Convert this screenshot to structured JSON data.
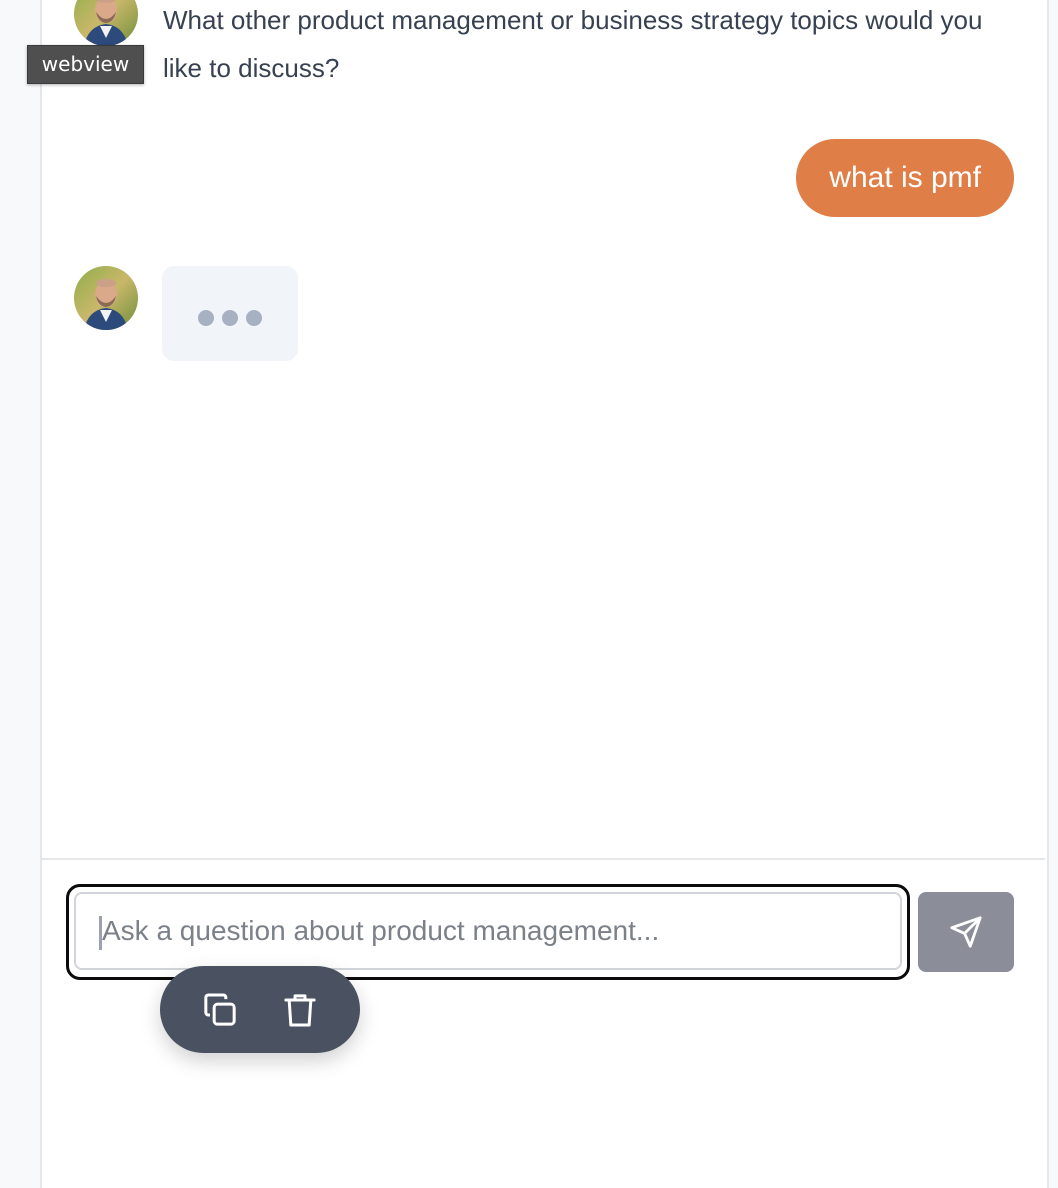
{
  "chat": {
    "messages": [
      {
        "role": "assistant",
        "avatar": "person-avatar",
        "text": "What other product management or business strategy topics would you like to discuss?"
      },
      {
        "role": "user",
        "text": "what is pmf"
      },
      {
        "role": "assistant",
        "avatar": "person-avatar",
        "state": "typing-indicator"
      }
    ]
  },
  "composer": {
    "placeholder": "Ask a question about product management...",
    "value": "",
    "send_icon": "send-icon"
  },
  "context_toolbar": {
    "actions": [
      {
        "icon": "copy-icon"
      },
      {
        "icon": "trash-icon"
      }
    ]
  },
  "overlay_tag": {
    "label": "webview"
  },
  "colors": {
    "user_bubble": "#e07e48",
    "typing_bubble": "#f1f4f8",
    "send_button": "#8b8e98",
    "toolbar": "#4a5160",
    "text": "#374151"
  }
}
